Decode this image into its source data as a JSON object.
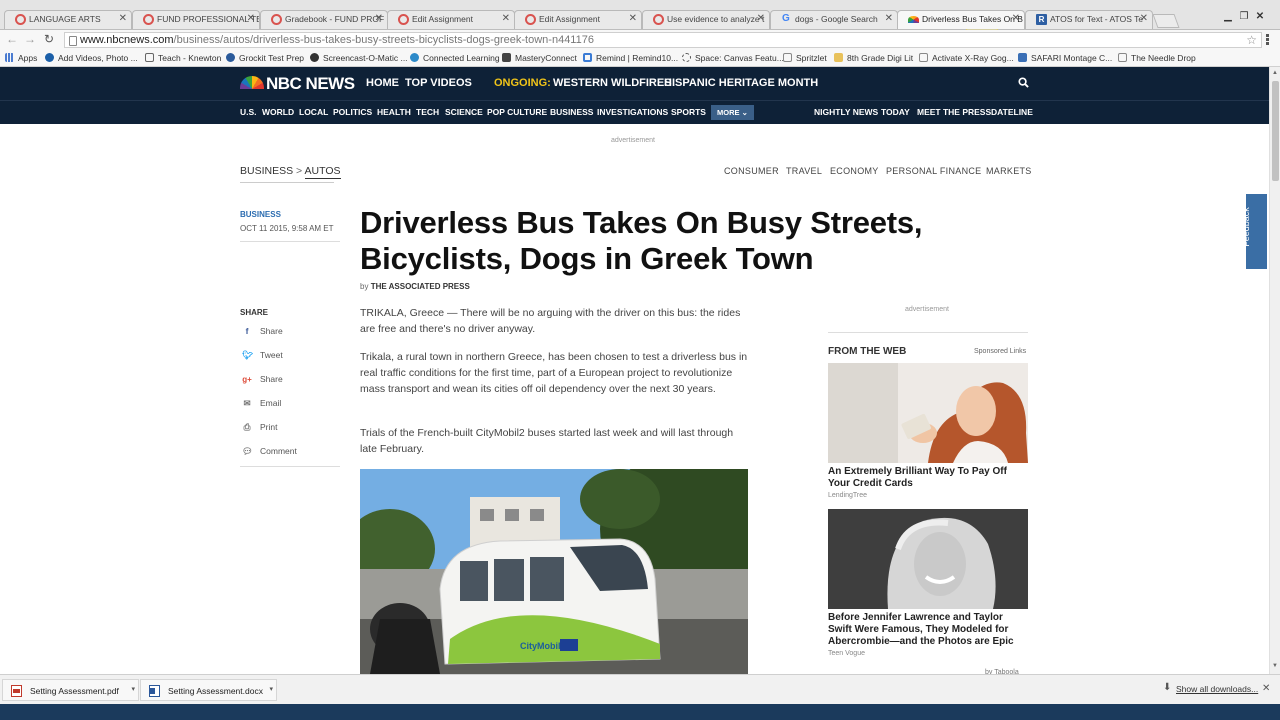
{
  "browser": {
    "tabs": [
      {
        "title": "LANGUAGE ARTS",
        "icon": "canvas-icon"
      },
      {
        "title": "FUND PROFESSIONAL TE",
        "icon": "canvas-icon"
      },
      {
        "title": "Gradebook - FUND PROF",
        "icon": "canvas-icon"
      },
      {
        "title": "Edit Assignment",
        "icon": "canvas-icon"
      },
      {
        "title": "Edit Assignment",
        "icon": "canvas-icon"
      },
      {
        "title": "Use evidence to analyze t",
        "icon": "canvas-icon"
      },
      {
        "title": "dogs - Google Search",
        "icon": "google-icon"
      },
      {
        "title": "Driverless Bus Takes On B",
        "icon": "nbc-icon",
        "active": true
      },
      {
        "title": "ATOS for Text - ATOS Te",
        "icon": "atos-icon"
      }
    ],
    "url_host": "www.nbcnews.com",
    "url_path": "/business/autos/driverless-bus-takes-busy-streets-bicyclists-dogs-greek-town-n441176",
    "bookmarks": [
      "Apps",
      "Add Videos, Photo ...",
      "Teach - Knewton",
      "Grockit Test Prep",
      "Screencast-O-Matic ...",
      "Connected Learning",
      "MasteryConnect",
      "Remind | Remind10...",
      "Space: Canvas Featu...",
      "Spritzlet",
      "8th Grade Digi Lit",
      "Activate X-Ray Gog...",
      "SAFARI Montage C...",
      "The Needle Drop"
    ]
  },
  "nbc": {
    "logo": "NBC NEWS",
    "topnav": [
      "HOME",
      "TOP VIDEOS"
    ],
    "ongoing_label": "ONGOING:",
    "ongoing_items": [
      "WESTERN WILDFIRES",
      "HISPANIC HERITAGE MONTH"
    ],
    "subnav_left": [
      "U.S.",
      "WORLD",
      "LOCAL",
      "POLITICS",
      "HEALTH",
      "TECH",
      "SCIENCE",
      "POP CULTURE",
      "BUSINESS",
      "INVESTIGATIONS",
      "SPORTS"
    ],
    "more_label": "MORE",
    "subnav_right": [
      "NIGHTLY NEWS",
      "TODAY",
      "MEET THE PRESS",
      "DATELINE"
    ]
  },
  "page": {
    "ad_label": "advertisement",
    "breadcrumb": {
      "section": "BUSINESS",
      "separator": ">",
      "current": "AUTOS"
    },
    "section_nav": [
      "CONSUMER",
      "TRAVEL",
      "ECONOMY",
      "PERSONAL FINANCE",
      "MARKETS"
    ],
    "kicker": "BUSINESS",
    "date": "OCT 11 2015, 9:58 AM ET",
    "headline": "Driverless Bus Takes On Busy Streets, Bicyclists, Dogs in Greek Town",
    "byline_prefix": "by",
    "byline_author": "THE ASSOCIATED PRESS",
    "share_label": "SHARE",
    "share_items": [
      {
        "label": "Share",
        "icon": "facebook-icon"
      },
      {
        "label": "Tweet",
        "icon": "twitter-icon"
      },
      {
        "label": "Share",
        "icon": "googleplus-icon"
      },
      {
        "label": "Email",
        "icon": "email-icon"
      },
      {
        "label": "Print",
        "icon": "print-icon"
      },
      {
        "label": "Comment",
        "icon": "comment-icon"
      }
    ],
    "paragraphs": [
      "TRIKALA, Greece — There will be no arguing with the driver on this bus: the rides are free and there's no driver anyway.",
      "Trikala, a rural town in northern Greece, has been chosen to test a driverless bus in real traffic conditions for the first time, part of a European project to revolutionize mass transport and wean its cities off oil dependency over the next 30 years.",
      "Trials of the French-built CityMobil2 buses started last week and will last through late February."
    ],
    "bus_text": "CityMobil2",
    "rail": {
      "ad_label": "advertisement",
      "heading": "FROM THE WEB",
      "sponsored": "Sponsored Links",
      "cards": [
        {
          "title": "An Extremely Brilliant Way To Pay Off Your Credit Cards",
          "source": "LendingTree"
        },
        {
          "title": "Before Jennifer Lawrence and Taylor Swift Were Famous, They Modeled for Abercrombie—and the Photos are Epic",
          "source": "Teen Vogue"
        }
      ],
      "taboola": "by Taboola"
    },
    "feedback_label": "Feedback"
  },
  "downloads": {
    "items": [
      {
        "name": "Setting Assessment.pdf",
        "icon": "pdf-icon"
      },
      {
        "name": "Setting Assessment.docx",
        "icon": "word-icon"
      }
    ],
    "show_all": "Show all downloads..."
  },
  "colors": {
    "nbc_navy": "#0e2137",
    "ongoing_yellow": "#f0c419",
    "more_blue": "#3a5f88",
    "kicker_blue": "#2b6cb0"
  }
}
